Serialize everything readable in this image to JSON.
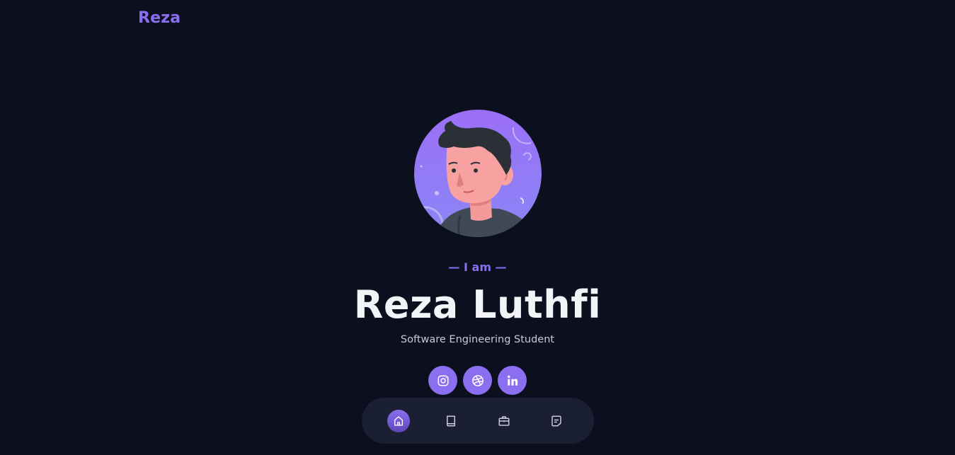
{
  "header": {
    "logo_text": "Reza"
  },
  "hero": {
    "avatar_alt": "avatar-illustration",
    "intro": "— I am —",
    "name": "Reza Luthfi",
    "role": "Software Engineering Student"
  },
  "socials": [
    {
      "icon": "instagram-icon"
    },
    {
      "icon": "dribbble-icon"
    },
    {
      "icon": "linkedin-icon"
    }
  ],
  "nav": {
    "items": [
      {
        "icon": "home-icon",
        "active": true
      },
      {
        "icon": "book-icon",
        "active": false
      },
      {
        "icon": "briefcase-icon",
        "active": false
      },
      {
        "icon": "message-icon",
        "active": false
      }
    ]
  },
  "colors": {
    "background": "#0b0f1e",
    "accent": "#8b6ff0",
    "nav_background": "#1b1f33",
    "title": "#f3f4f8",
    "subtitle": "#c8cad6"
  }
}
